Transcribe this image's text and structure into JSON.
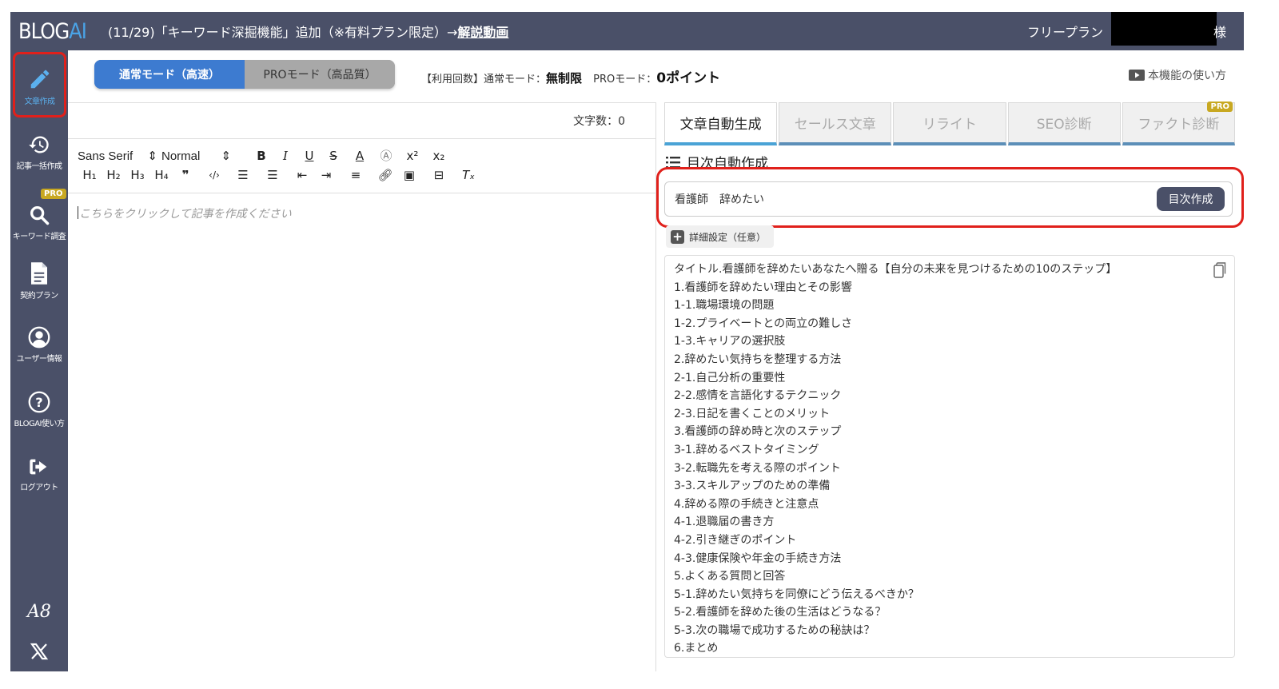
{
  "header": {
    "logo_main": "BLOG",
    "logo_accent": "AI",
    "announcement": "(11/29)「キーワード深掘機能」追加（※有料プラン限定）→",
    "announcement_link": "解説動画",
    "plan": "フリープラン",
    "suffix": "様"
  },
  "sidebar": {
    "items": [
      {
        "label": "文章作成",
        "icon": "pencil-icon"
      },
      {
        "label": "記事一括作成",
        "icon": "history-icon"
      },
      {
        "label": "キーワード調査",
        "icon": "search-icon",
        "badge": "PRO"
      },
      {
        "label": "契約プラン",
        "icon": "document-icon"
      },
      {
        "label": "ユーザー情報",
        "icon": "user-icon"
      },
      {
        "label": "BLOGAI使い方",
        "icon": "help-icon"
      },
      {
        "label": "ログアウト",
        "icon": "logout-icon"
      }
    ],
    "bottom": {
      "a8": "A8",
      "x": "X"
    }
  },
  "modes": {
    "normal": "通常モード（高速）",
    "pro": "PROモード（高品質）"
  },
  "usage": {
    "prefix": "【利用回数】通常モード：",
    "normal_value": "無制限",
    "pro_label": "PROモード：",
    "pro_value": "0ポイント"
  },
  "howto": "本機能の使い方",
  "editor": {
    "char_count": "文字数：0",
    "font": "Sans Serif",
    "size": "Normal",
    "placeholder": "こちらをクリックして記事を作成ください"
  },
  "tabs": [
    {
      "label": "文章自動生成",
      "active": true
    },
    {
      "label": "セールス文章"
    },
    {
      "label": "リライト"
    },
    {
      "label": "SEO診断"
    },
    {
      "label": "ファクト診断",
      "badge": "PRO"
    }
  ],
  "toc": {
    "heading": "目次自動作成",
    "keyword": "看護師　辞めたい",
    "button": "目次作成",
    "detail": "詳細設定（任意）",
    "lines": [
      "タイトル.看護師を辞めたいあなたへ贈る【自分の未来を見つけるための10のステップ】",
      "1.看護師を辞めたい理由とその影響",
      "1-1.職場環境の問題",
      "1-2.プライベートとの両立の難しさ",
      "1-3.キャリアの選択肢",
      "2.辞めたい気持ちを整理する方法",
      "2-1.自己分析の重要性",
      "2-2.感情を言語化するテクニック",
      "2-3.日記を書くことのメリット",
      "3.看護師の辞め時と次のステップ",
      "3-1.辞めるベストタイミング",
      "3-2.転職先を考える際のポイント",
      "3-3.スキルアップのための準備",
      "4.辞める際の手続きと注意点",
      "4-1.退職届の書き方",
      "4-2.引き継ぎのポイント",
      "4-3.健康保険や年金の手続き方法",
      "5.よくある質問と回答",
      "5-1.辞めたい気持ちを同僚にどう伝えるべきか？",
      "5-2.看護師を辞めた後の生活はどうなる？",
      "5-3.次の職場で成功するための秘訣は？",
      "6.まとめ"
    ]
  },
  "colors": {
    "header_bg": "#4a5068",
    "accent_blue": "#3d7bd0",
    "highlight_red": "#e0201b",
    "pro_gold": "#c8a821"
  }
}
